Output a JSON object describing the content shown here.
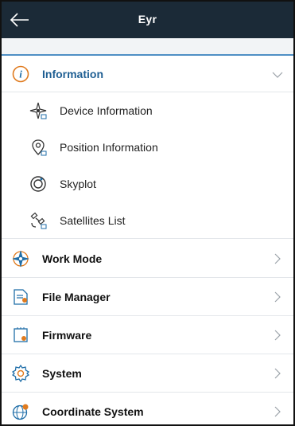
{
  "header": {
    "title": "Eyr",
    "back_icon": "back-arrow-icon"
  },
  "accent_color": "#1f6ea8",
  "menu": {
    "information": {
      "label": "Information",
      "expanded": true,
      "icon": "info-circle-icon",
      "children": [
        {
          "label": "Device Information",
          "icon": "device-compass-icon"
        },
        {
          "label": "Position Information",
          "icon": "location-pin-icon"
        },
        {
          "label": "Skyplot",
          "icon": "skyplot-icon"
        },
        {
          "label": "Satellites List",
          "icon": "satellite-icon"
        }
      ]
    },
    "items": [
      {
        "label": "Work Mode",
        "icon": "work-mode-compass-icon"
      },
      {
        "label": "File Manager",
        "icon": "file-manager-icon"
      },
      {
        "label": "Firmware",
        "icon": "firmware-chip-icon"
      },
      {
        "label": "System",
        "icon": "gear-icon"
      },
      {
        "label": "Coordinate System",
        "icon": "globe-pin-icon"
      }
    ]
  }
}
